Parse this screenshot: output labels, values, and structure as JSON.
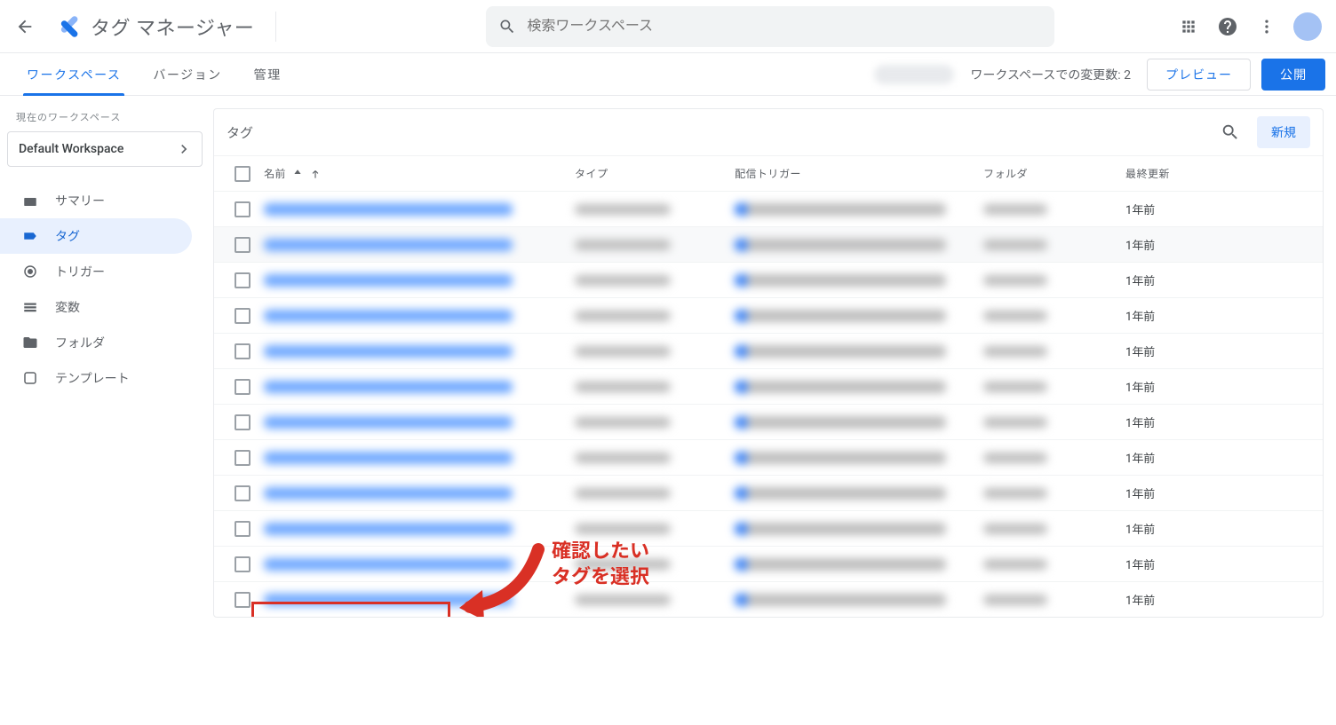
{
  "header": {
    "app_name": "タグ マネージャー",
    "search_placeholder": "検索ワークスペース"
  },
  "tabs": {
    "workspace": "ワークスペース",
    "versions": "バージョン",
    "admin": "管理"
  },
  "secondbar": {
    "changes_label": "ワークスペースでの変更数: 2",
    "preview": "プレビュー",
    "publish": "公開"
  },
  "sidebar": {
    "current_ws_label": "現在のワークスペース",
    "ws_name": "Default Workspace",
    "items": [
      {
        "label": "サマリー"
      },
      {
        "label": "タグ"
      },
      {
        "label": "トリガー"
      },
      {
        "label": "変数"
      },
      {
        "label": "フォルダ"
      },
      {
        "label": "テンプレート"
      }
    ]
  },
  "panel": {
    "title": "タグ",
    "new_button": "新規",
    "columns": {
      "name": "名前",
      "type": "タイプ",
      "trigger": "配信トリガー",
      "folder": "フォルダ",
      "updated": "最終更新"
    },
    "rows": [
      {
        "updated": "1年前"
      },
      {
        "updated": "1年前"
      },
      {
        "updated": "1年前"
      },
      {
        "updated": "1年前"
      },
      {
        "updated": "1年前"
      },
      {
        "updated": "1年前"
      },
      {
        "updated": "1年前"
      },
      {
        "updated": "1年前"
      },
      {
        "updated": "1年前"
      },
      {
        "updated": "1年前"
      },
      {
        "updated": "1年前"
      },
      {
        "updated": "1年前"
      }
    ]
  },
  "annotation": {
    "text": "確認したい\nタグを選択"
  }
}
